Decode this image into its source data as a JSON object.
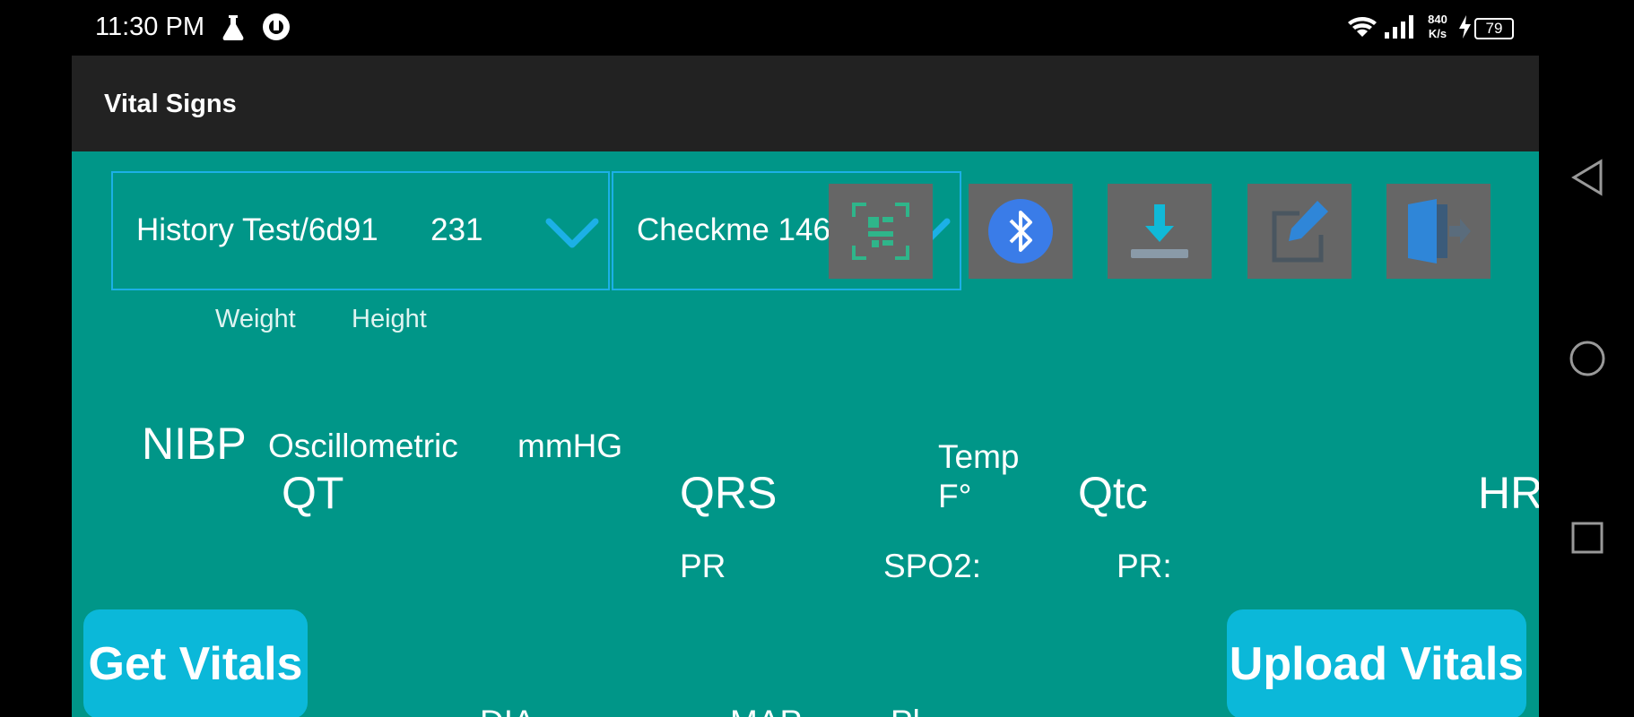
{
  "status_bar": {
    "time": "11:30 PM",
    "net_speed_top": "840",
    "net_speed_bottom": "K/s",
    "battery": "79"
  },
  "app_bar": {
    "title": "Vital Signs"
  },
  "patient_dropdown": {
    "value": "History Test/6d91      231"
  },
  "device_dropdown": {
    "value": "Checkme 1467"
  },
  "toolbar": {
    "icons": [
      "qr-scan-icon",
      "bluetooth-icon",
      "download-icon",
      "edit-icon",
      "logout-icon"
    ]
  },
  "labels": {
    "weight": "Weight",
    "height": "Height",
    "nibp": "NIBP",
    "oscillometric": "Oscillometric",
    "mmhg": "mmHG",
    "qt": "QT",
    "qrs": "QRS",
    "temp": "Temp",
    "temp_unit": "F°",
    "qtc": "Qtc",
    "hr": "HR",
    "pr": "PR",
    "spo2": "SPO2:",
    "pr_colon": "PR:",
    "dia": "DIA",
    "map": "MAP",
    "pl": "Pl"
  },
  "buttons": {
    "get_vitals": "Get Vitals",
    "upload_vitals": "Upload Vitals"
  },
  "colors": {
    "teal_background": "#009688",
    "button_cyan": "#0bb8d9",
    "accent_blue": "#1cb0e6",
    "app_bar": "#222222"
  }
}
